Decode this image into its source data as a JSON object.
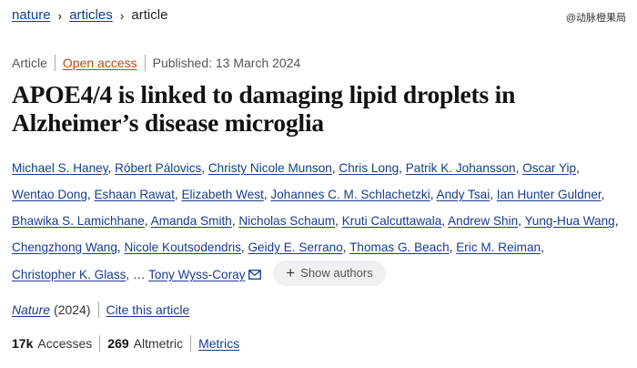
{
  "breadcrumb": {
    "items": [
      "nature",
      "articles"
    ],
    "current": "article"
  },
  "watermark": "@动脉橙果局",
  "meta": {
    "type": "Article",
    "open_access": "Open access",
    "published": "Published: 13 March 2024"
  },
  "title": "APOE4/4 is linked to damaging lipid droplets in Alzheimer’s disease microglia",
  "authors": {
    "list": [
      "Michael S. Haney",
      "Róbert Pálovics",
      "Christy Nicole Munson",
      "Chris Long",
      "Patrik K. Johansson",
      "Oscar Yip",
      "Wentao Dong",
      "Eshaan Rawat",
      "Elizabeth West",
      "Johannes C. M. Schlachetzki",
      "Andy Tsai",
      "Ian Hunter Guldner",
      "Bhawika S. Lamichhane",
      "Amanda Smith",
      "Nicholas Schaum",
      "Kruti Calcuttawala",
      "Andrew Shin",
      "Yung-Hua Wang",
      "Chengzhong Wang",
      "Nicole Koutsodendris",
      "Geidy E. Serrano",
      "Thomas G. Beach",
      "Eric M. Reiman",
      "Christopher K. Glass"
    ],
    "ellipsis": "…",
    "last": "Tony Wyss-Coray",
    "show_label": "Show authors"
  },
  "citation": {
    "journal": "Nature",
    "year": "(2024)",
    "cite_label": "Cite this article"
  },
  "metrics": {
    "accesses_num": "17k",
    "accesses_label": "Accesses",
    "altmetric_num": "269",
    "altmetric_label": "Altmetric",
    "metrics_label": "Metrics"
  },
  "colors": {
    "link": "#1a3b8c",
    "open_access": "#b5481d",
    "pill_bg": "#eef0f3"
  },
  "icons": [
    "chevron-right-icon",
    "mail-icon",
    "plus-icon"
  ]
}
